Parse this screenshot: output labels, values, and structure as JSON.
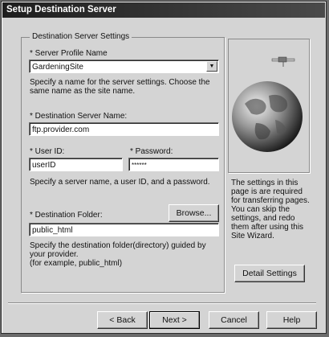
{
  "window": {
    "title": "Setup Destination Server"
  },
  "group": {
    "title": "Destination Server Settings"
  },
  "profile": {
    "label": "* Server Profile Name",
    "value": "GardeningSite",
    "help": "Specify a name for the server settings. Choose the same name as the site name."
  },
  "server": {
    "label": "* Destination Server Name:",
    "value": "ftp.provider.com"
  },
  "user": {
    "label": "* User ID:",
    "value": "userID"
  },
  "password": {
    "label": "* Password:",
    "value": "******"
  },
  "server_help": "Specify a server name, a user ID, and a password.",
  "folder": {
    "label": "* Destination Folder:",
    "browse_label": "Browse...",
    "value": "public_html",
    "help": "Specify the destination folder(directory) guided by your provider.",
    "help2": "(for example, public_html)"
  },
  "side_text": "The settings in this page is are required for transferring pages. You can skip the settings, and redo them after using this Site Wizard.",
  "detail_button": "Detail Settings",
  "footer": {
    "back": "< Back",
    "next": "Next >",
    "cancel": "Cancel",
    "help": "Help"
  },
  "icons": {
    "globe": "globe-icon",
    "satellite": "satellite-icon",
    "dropdown": "chevron-down-icon"
  }
}
